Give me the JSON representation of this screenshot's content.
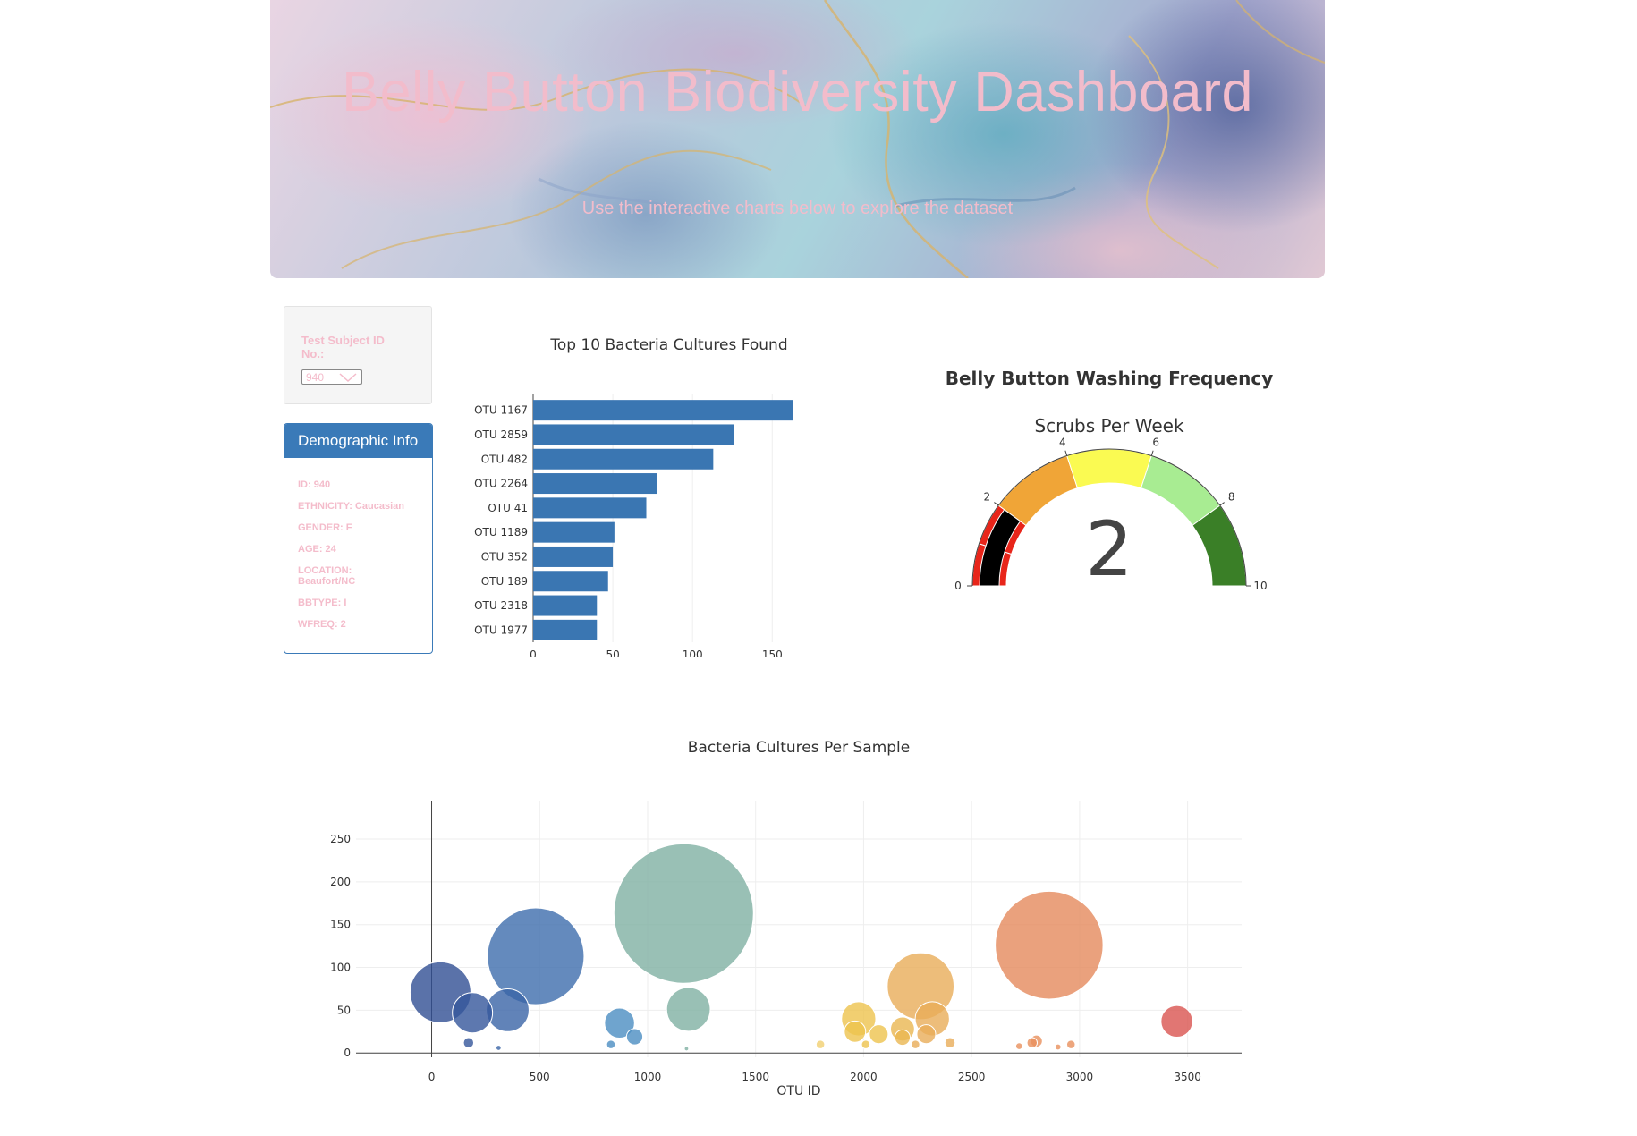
{
  "header": {
    "title": "Belly Button Biodiversity Dashboard",
    "subtitle": "Use the interactive charts below to explore the dataset"
  },
  "selector": {
    "label": "Test Subject ID No.:",
    "selected": "940"
  },
  "demographics": {
    "title": "Demographic Info",
    "rows": [
      "ID: 940",
      "ETHNICITY: Caucasian",
      "GENDER: F",
      "AGE: 24",
      "LOCATION: Beaufort/NC",
      "BBTYPE: I",
      "WFREQ: 2"
    ]
  },
  "chart_data": [
    {
      "type": "bar",
      "orientation": "horizontal",
      "title": "Top 10 Bacteria Cultures Found",
      "categories": [
        "OTU 1167",
        "OTU 2859",
        "OTU 482",
        "OTU 2264",
        "OTU 41",
        "OTU 1189",
        "OTU 352",
        "OTU 189",
        "OTU 2318",
        "OTU 1977"
      ],
      "values": [
        163,
        126,
        113,
        78,
        71,
        51,
        50,
        47,
        40,
        40
      ],
      "xlim": [
        0,
        165
      ],
      "xticks": [
        0,
        50,
        100,
        150
      ],
      "color": "#3a76b2",
      "grid": true
    },
    {
      "type": "gauge",
      "title": "Belly Button Washing Frequency",
      "subtitle": "Scrubs Per Week",
      "value": 2,
      "range": [
        0,
        10
      ],
      "ticks": [
        0,
        2,
        4,
        6,
        8,
        10
      ],
      "steps": [
        {
          "from": 0,
          "to": 1,
          "color": "#e8251a"
        },
        {
          "from": 1,
          "to": 2,
          "color": "#e8251a"
        },
        {
          "from": 2,
          "to": 4,
          "color": "#f0a537"
        },
        {
          "from": 4,
          "to": 6,
          "color": "#fafa52"
        },
        {
          "from": 6,
          "to": 8,
          "color": "#a8ec92"
        },
        {
          "from": 8,
          "to": 10,
          "color": "#3a7f27"
        }
      ],
      "bar_color": "#000000"
    },
    {
      "type": "scatter",
      "subtype": "bubble",
      "title": "Bacteria Cultures Per Sample",
      "xlabel": "OTU ID",
      "ylabel": "",
      "xlim": [
        -350,
        3750
      ],
      "ylim": [
        -5,
        295
      ],
      "xticks": [
        0,
        500,
        1000,
        1500,
        2000,
        2500,
        3000,
        3500
      ],
      "yticks": [
        0,
        50,
        100,
        150,
        200,
        250
      ],
      "grid": true,
      "points": [
        {
          "x": 41,
          "y": 71,
          "c": "#314f94"
        },
        {
          "x": 189,
          "y": 47,
          "c": "#34569b"
        },
        {
          "x": 171,
          "y": 12,
          "c": "#34569b"
        },
        {
          "x": 352,
          "y": 50,
          "c": "#3a64a6"
        },
        {
          "x": 482,
          "y": 113,
          "c": "#3d6dad"
        },
        {
          "x": 310,
          "y": 6,
          "c": "#3a64a6"
        },
        {
          "x": 870,
          "y": 35,
          "c": "#4b8dc2"
        },
        {
          "x": 940,
          "y": 19,
          "c": "#4b8dc2"
        },
        {
          "x": 830,
          "y": 10,
          "c": "#4b8dc2"
        },
        {
          "x": 1167,
          "y": 163,
          "c": "#7fb0a3"
        },
        {
          "x": 1189,
          "y": 51,
          "c": "#7fb0a3"
        },
        {
          "x": 1180,
          "y": 5,
          "c": "#7fb0a3"
        },
        {
          "x": 1800,
          "y": 10,
          "c": "#f1d070"
        },
        {
          "x": 1977,
          "y": 40,
          "c": "#eec34e"
        },
        {
          "x": 1960,
          "y": 25,
          "c": "#eec34e"
        },
        {
          "x": 2010,
          "y": 10,
          "c": "#eec34e"
        },
        {
          "x": 2070,
          "y": 22,
          "c": "#eec34e"
        },
        {
          "x": 2180,
          "y": 28,
          "c": "#eab651"
        },
        {
          "x": 2180,
          "y": 18,
          "c": "#eab651"
        },
        {
          "x": 2264,
          "y": 78,
          "c": "#e9ad59"
        },
        {
          "x": 2318,
          "y": 40,
          "c": "#e9ad59"
        },
        {
          "x": 2290,
          "y": 22,
          "c": "#e9ad59"
        },
        {
          "x": 2240,
          "y": 10,
          "c": "#e9ad59"
        },
        {
          "x": 2400,
          "y": 12,
          "c": "#e9ad59"
        },
        {
          "x": 2720,
          "y": 8,
          "c": "#e8905c"
        },
        {
          "x": 2780,
          "y": 12,
          "c": "#e8905c"
        },
        {
          "x": 2800,
          "y": 14,
          "c": "#e8905c"
        },
        {
          "x": 2859,
          "y": 126,
          "c": "#e58a5d"
        },
        {
          "x": 2900,
          "y": 7,
          "c": "#e8905c"
        },
        {
          "x": 2960,
          "y": 10,
          "c": "#e8905c"
        },
        {
          "x": 3450,
          "y": 37,
          "c": "#d95450"
        }
      ]
    }
  ]
}
